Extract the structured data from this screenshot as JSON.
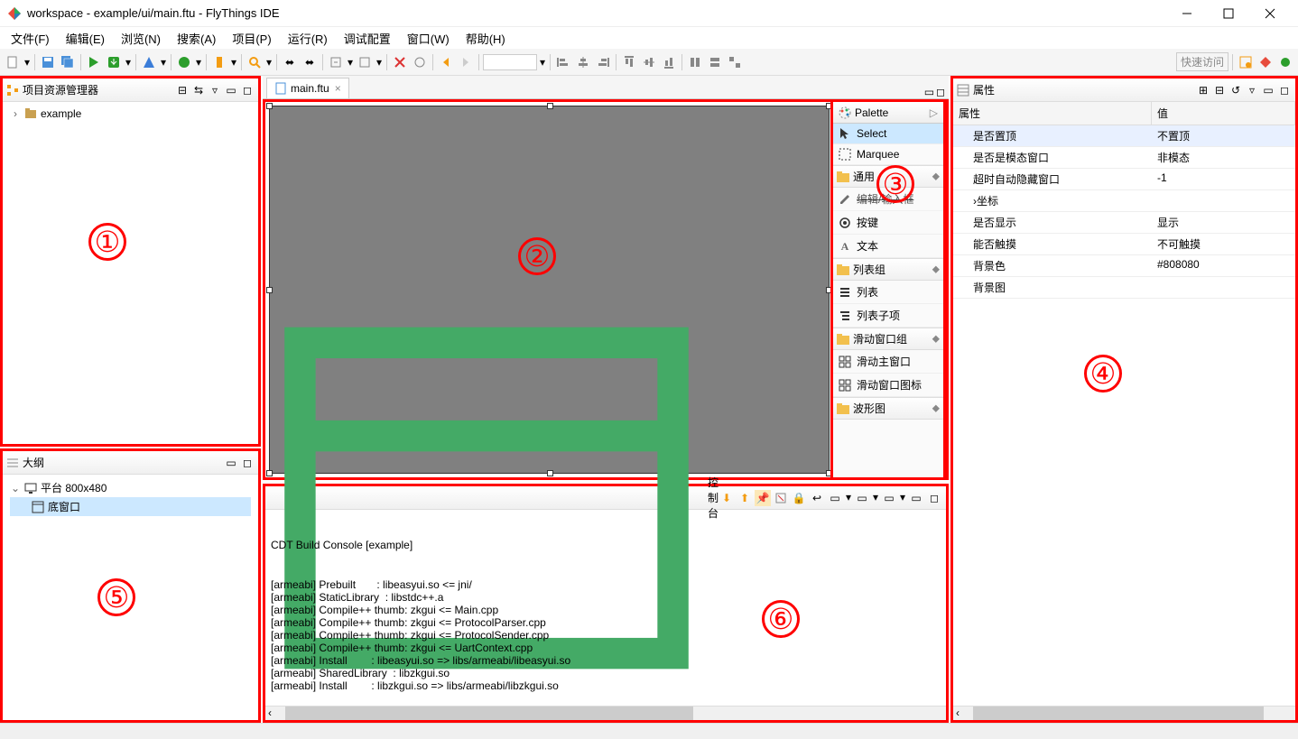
{
  "window": {
    "title": "workspace - example/ui/main.ftu - FlyThings IDE"
  },
  "menu": {
    "file": "文件(F)",
    "edit": "编辑(E)",
    "browse": "浏览(N)",
    "search": "搜索(A)",
    "project": "项目(P)",
    "run": "运行(R)",
    "debug_config": "调试配置",
    "window": "窗口(W)",
    "help": "帮助(H)"
  },
  "toolbar": {
    "quick_access": "快速访问"
  },
  "explorer": {
    "title": "项目资源管理器",
    "root": "example"
  },
  "editor": {
    "tab": "main.ftu"
  },
  "palette": {
    "title": "Palette",
    "select": "Select",
    "marquee": "Marquee",
    "group_common": "通用",
    "edit_input": "编辑/输入框",
    "button": "按键",
    "text": "文本",
    "group_list": "列表组",
    "list": "列表",
    "list_sub": "列表子项",
    "group_slide": "滑动窗口组",
    "slide_main": "滑动主窗口",
    "slide_icon": "滑动窗口图标",
    "group_wave": "波形图"
  },
  "properties": {
    "title": "属性",
    "col_key": "属性",
    "col_val": "值",
    "rows": [
      {
        "k": "是否置顶",
        "v": "不置顶"
      },
      {
        "k": "是否是模态窗口",
        "v": "非模态"
      },
      {
        "k": "超时自动隐藏窗口",
        "v": "-1"
      },
      {
        "k": "坐标",
        "v": ""
      },
      {
        "k": "是否显示",
        "v": "显示"
      },
      {
        "k": "能否触摸",
        "v": "不可触摸"
      },
      {
        "k": "背景色",
        "v": "#808080"
      },
      {
        "k": "背景图",
        "v": ""
      }
    ]
  },
  "outline": {
    "title": "大纲",
    "platform": "平台 800x480",
    "bottom_win": "底窗口"
  },
  "console": {
    "title": "控制台",
    "header": "CDT Build Console [example]",
    "lines": [
      "[armeabi] Prebuilt       : libeasyui.so <= jni/",
      "[armeabi] StaticLibrary  : libstdc++.a",
      "[armeabi] Compile++ thumb: zkgui <= Main.cpp",
      "[armeabi] Compile++ thumb: zkgui <= ProtocolParser.cpp",
      "[armeabi] Compile++ thumb: zkgui <= ProtocolSender.cpp",
      "[armeabi] Compile++ thumb: zkgui <= UartContext.cpp",
      "[armeabi] Install        : libeasyui.so => libs/armeabi/libeasyui.so",
      "[armeabi] SharedLibrary  : libzkgui.so",
      "[armeabi] Install        : libzkgui.so => libs/armeabi/libzkgui.so"
    ]
  },
  "annotations": {
    "n1": "①",
    "n2": "②",
    "n3": "③",
    "n4": "④",
    "n5": "⑤",
    "n6": "⑥"
  }
}
